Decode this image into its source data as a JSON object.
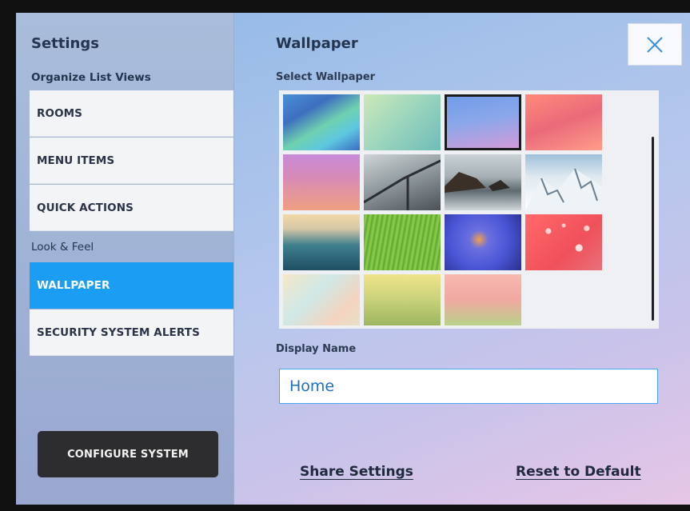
{
  "sidebar": {
    "title": "Settings",
    "section_organize": "Organize List Views",
    "organize_items": [
      {
        "label": "ROOMS"
      },
      {
        "label": "MENU ITEMS"
      },
      {
        "label": "QUICK ACTIONS"
      }
    ],
    "section_look": "Look & Feel",
    "look_items": [
      {
        "label": "WALLPAPER",
        "active": true
      },
      {
        "label": "SECURITY SYSTEM ALERTS",
        "active": false
      }
    ],
    "configure_button": "CONFIGURE SYSTEM"
  },
  "main": {
    "title": "Wallpaper",
    "close_icon": "close-icon",
    "select_label": "Select Wallpaper",
    "wallpapers": [
      {
        "name": "green-blue-polygon",
        "selected": false
      },
      {
        "name": "mint-gradient",
        "selected": false
      },
      {
        "name": "blue-pink-gradient",
        "selected": true
      },
      {
        "name": "red-gradient",
        "selected": false
      },
      {
        "name": "purple-orange-gradient",
        "selected": false
      },
      {
        "name": "foggy-bridge",
        "selected": false
      },
      {
        "name": "rocky-seashore",
        "selected": false
      },
      {
        "name": "snowy-mountains",
        "selected": false
      },
      {
        "name": "teal-hills-sunset",
        "selected": false
      },
      {
        "name": "green-grass",
        "selected": false
      },
      {
        "name": "blue-flower",
        "selected": false
      },
      {
        "name": "red-bokeh",
        "selected": false
      },
      {
        "name": "pastel-watercolor",
        "selected": false
      },
      {
        "name": "yellow-green-texture",
        "selected": false
      },
      {
        "name": "pink-green-gradient",
        "selected": false
      }
    ],
    "display_name_label": "Display Name",
    "display_name_value": "Home",
    "share_settings": "Share Settings",
    "reset_default": "Reset to Default"
  }
}
